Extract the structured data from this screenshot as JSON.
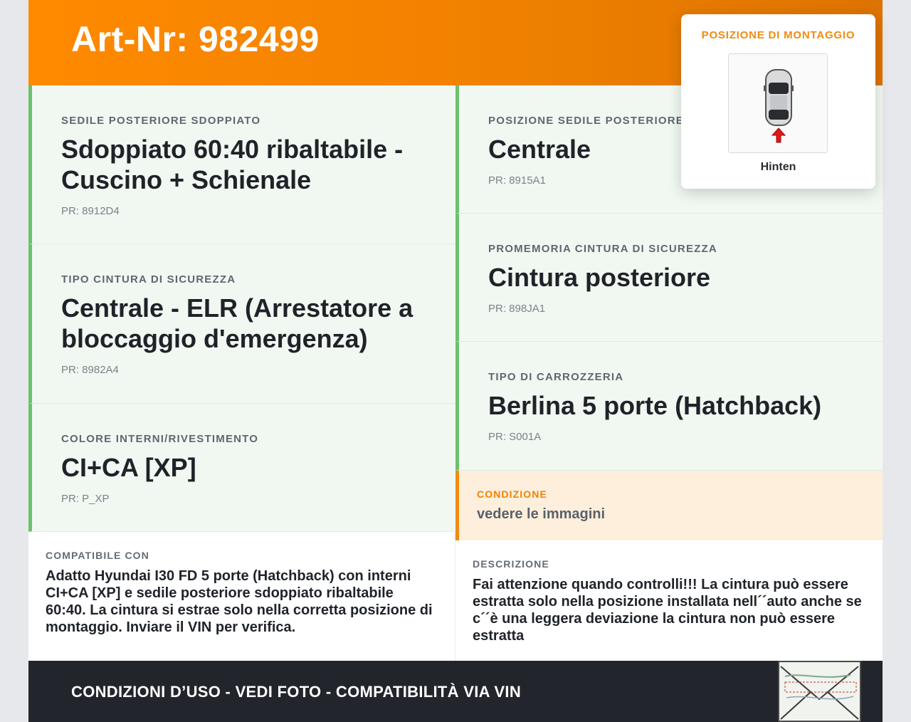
{
  "header": {
    "title": "Art-Nr: 982499"
  },
  "left_specs": [
    {
      "label": "SEDILE POSTERIORE SDOPPIATO",
      "value": "Sdoppiato 60:40 ribaltabile - Cuscino + Schienale",
      "pr": "PR: 8912D4"
    },
    {
      "label": "TIPO CINTURA DI SICUREZZA",
      "value": "Centrale - ELR (Arrestatore a bloccaggio d'emergenza)",
      "pr": "PR: 8982A4"
    },
    {
      "label": "COLORE INTERNI/RIVESTIMENTO",
      "value": "CI+CA [XP]",
      "pr": "PR: P_XP"
    }
  ],
  "right_specs": [
    {
      "label": "POSIZIONE SEDILE POSTERIORE",
      "value": "Centrale",
      "pr": "PR: 8915A1"
    },
    {
      "label": "PROMEMORIA CINTURA DI SICUREZZA",
      "value": "Cintura posteriore",
      "pr": "PR: 898JA1"
    },
    {
      "label": "TIPO DI CARROZZERIA",
      "value": "Berlina 5 porte (Hatchback)",
      "pr": "PR: S001A"
    }
  ],
  "condition": {
    "label": "CONDIZIONE",
    "value": "vedere le immagini"
  },
  "compatible": {
    "label": "COMPATIBILE CON",
    "text": "Adatto Hyundai I30 FD 5 porte (Hatchback) con interni CI+CA [XP] e sedile posteriore sdoppiato ribaltabile 60:40. La cintura si estrae solo nella corretta posizione di montaggio. Inviare il VIN per verifica."
  },
  "description": {
    "label": "DESCRIZIONE",
    "text": "Fai attenzione quando controlli!!! La cintura può essere estratta solo nella posizione installata nell´´auto anche se c´´è una leggera deviazione la cintura non può essere estratta"
  },
  "footer": {
    "text": "CONDIZIONI D’USO - VEDI FOTO - COMPATIBILITÀ VIA VIN"
  },
  "mounting_popup": {
    "title": "POSIZIONE DI MONTAGGIO",
    "caption": "Hinten"
  },
  "colors": {
    "accent": "#ff8a00",
    "spec_bg": "#f1f8f1",
    "spec_border": "#6cc26e",
    "condition_bg": "#fdefdc",
    "footer_bg": "#22252b"
  },
  "icons": {
    "car": "car-top-view-icon",
    "arrow": "arrow-up-icon",
    "stamp": "envelope-stamp-icon"
  }
}
